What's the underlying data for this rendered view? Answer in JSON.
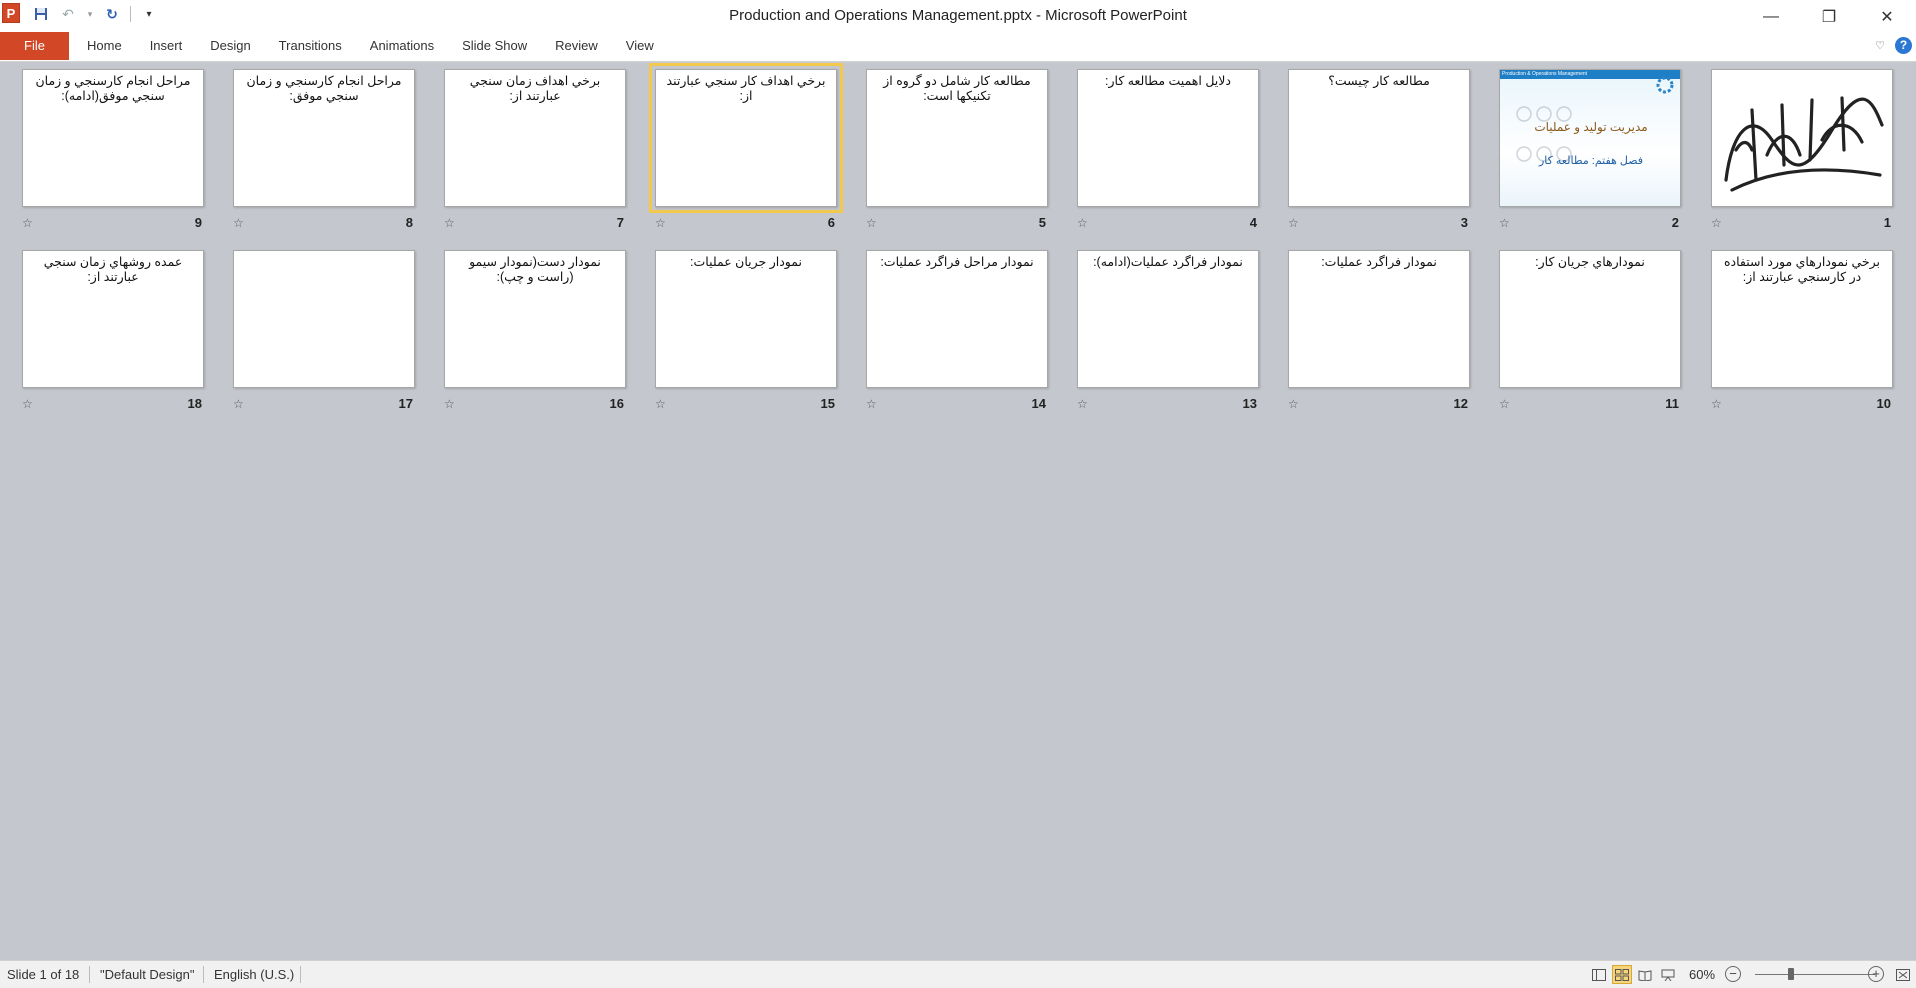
{
  "window": {
    "title": "Production and Operations Management.pptx  -  Microsoft PowerPoint",
    "logo_letter": "P",
    "controls": {
      "minimize": "—",
      "restore": "❐",
      "close": "✕"
    }
  },
  "qat": {
    "save": "💾",
    "undo": "↶",
    "undo_menu": "▾",
    "redo": "↻",
    "customize": "▾"
  },
  "ribbon": {
    "file_label": "File",
    "tabs": [
      "Home",
      "Insert",
      "Design",
      "Transitions",
      "Animations",
      "Slide Show",
      "Review",
      "View"
    ],
    "minimize_icon": "♡",
    "help_label": "?"
  },
  "slides": [
    {
      "number": "1",
      "title": ""
    },
    {
      "number": "2",
      "title": "",
      "design_header": "Production & Operations Management",
      "design_title": "مديريت توليد و عمليات",
      "design_subtitle": "فصل هفتم: مطالعه كار"
    },
    {
      "number": "3",
      "title": "مطالعه کار چیست؟"
    },
    {
      "number": "4",
      "title": "دلايل اهميت مطالعه كار:"
    },
    {
      "number": "5",
      "title": "مطالعه كار شامل دو گروه از تكنيكها است:"
    },
    {
      "number": "6",
      "title": "برخي اهداف كار سنجي عبارتند از:"
    },
    {
      "number": "7",
      "title": "برخي اهداف زمان سنجي عبارتند از:"
    },
    {
      "number": "8",
      "title": "مراحل انجام كارسنجي و زمان سنجي موفق:"
    },
    {
      "number": "9",
      "title": "مراحل انجام كارسنجي و زمان سنجي موفق(ادامه):"
    },
    {
      "number": "10",
      "title": "برخي نمودارهاي مورد استفاده در كارسنجي عبارتند از:"
    },
    {
      "number": "11",
      "title": "نمودارهاي جريان كار:"
    },
    {
      "number": "12",
      "title": "نمودار فراگرد عمليات:"
    },
    {
      "number": "13",
      "title": "نمودار فراگرد عمليات(ادامه):"
    },
    {
      "number": "14",
      "title": "نمودار مراحل فراگرد عمليات:"
    },
    {
      "number": "15",
      "title": "نمودار جريان عمليات:"
    },
    {
      "number": "16",
      "title": "نمودار دست(نمودار سيمو (راست و چپ):"
    },
    {
      "number": "17",
      "title": ""
    },
    {
      "number": "18",
      "title": "عمده روشهاي زمان سنجي عبارتند از:"
    }
  ],
  "selected_slide": "6",
  "status": {
    "slide_info": "Slide 1 of 18",
    "theme": "\"Default Design\"",
    "language": "English (U.S.)",
    "zoom": "60%",
    "zoom_level_percent": 60
  },
  "colors": {
    "accent": "#d24726",
    "selection": "#f3c94d",
    "background": "#c4c8ce"
  }
}
